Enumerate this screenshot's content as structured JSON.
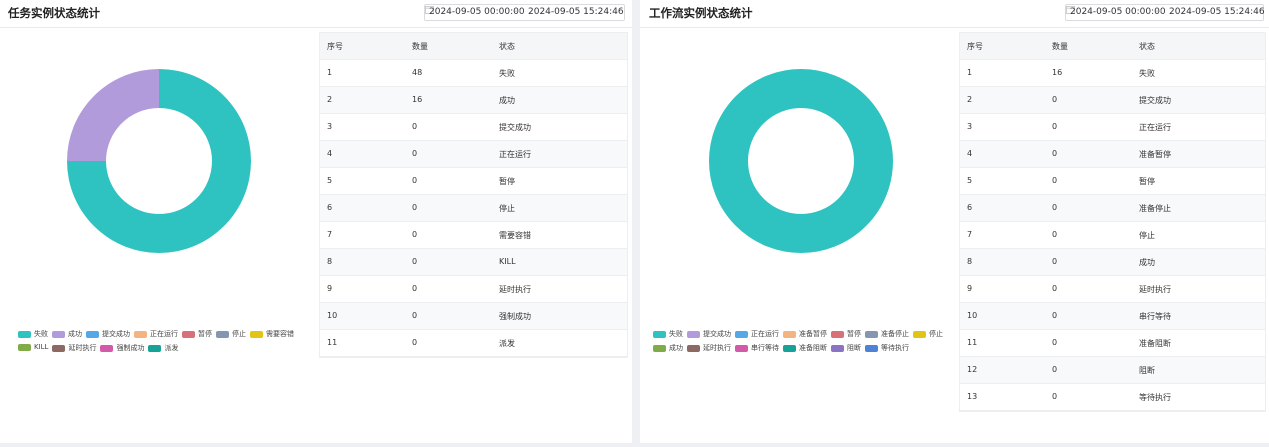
{
  "left": {
    "title": "任务实例状态统计",
    "date_start": "2024-09-05 00:00:00",
    "date_end": "2024-09-05 15:24:46",
    "date_arrow": "→",
    "columns": [
      "序号",
      "数量",
      "状态"
    ],
    "rows": [
      [
        "1",
        "48",
        "失败"
      ],
      [
        "2",
        "16",
        "成功"
      ],
      [
        "3",
        "0",
        "提交成功"
      ],
      [
        "4",
        "0",
        "正在运行"
      ],
      [
        "5",
        "0",
        "暂停"
      ],
      [
        "6",
        "0",
        "停止"
      ],
      [
        "7",
        "0",
        "需要容错"
      ],
      [
        "8",
        "0",
        "KILL"
      ],
      [
        "9",
        "0",
        "延时执行"
      ],
      [
        "10",
        "0",
        "强制成功"
      ],
      [
        "11",
        "0",
        "派发"
      ]
    ],
    "legend_rows": [
      [
        {
          "label": "失败",
          "color": "#2ec2c1"
        },
        {
          "label": "成功",
          "color": "#b19bdb"
        },
        {
          "label": "提交成功",
          "color": "#56a7e6"
        },
        {
          "label": "正在运行",
          "color": "#f3b482"
        },
        {
          "label": "暂停",
          "color": "#d8707a"
        },
        {
          "label": "停止",
          "color": "#8496b0"
        },
        {
          "label": "需要容错",
          "color": "#e2c415"
        }
      ],
      [
        {
          "label": "KILL",
          "color": "#80ab46"
        },
        {
          "label": "延时执行",
          "color": "#8c6a63"
        },
        {
          "label": "强制成功",
          "color": "#d35aa8"
        },
        {
          "label": "派发",
          "color": "#17a297"
        }
      ]
    ]
  },
  "right": {
    "title": "工作流实例状态统计",
    "date_start": "2024-09-05 00:00:00",
    "date_end": "2024-09-05 15:24:46",
    "date_arrow": "→",
    "columns": [
      "序号",
      "数量",
      "状态"
    ],
    "rows": [
      [
        "1",
        "16",
        "失败"
      ],
      [
        "2",
        "0",
        "提交成功"
      ],
      [
        "3",
        "0",
        "正在运行"
      ],
      [
        "4",
        "0",
        "准备暂停"
      ],
      [
        "5",
        "0",
        "暂停"
      ],
      [
        "6",
        "0",
        "准备停止"
      ],
      [
        "7",
        "0",
        "停止"
      ],
      [
        "8",
        "0",
        "成功"
      ],
      [
        "9",
        "0",
        "延时执行"
      ],
      [
        "10",
        "0",
        "串行等待"
      ],
      [
        "11",
        "0",
        "准备阻断"
      ],
      [
        "12",
        "0",
        "阻断"
      ],
      [
        "13",
        "0",
        "等待执行"
      ]
    ],
    "legend_rows": [
      [
        {
          "label": "失败",
          "color": "#2ec2c1"
        },
        {
          "label": "提交成功",
          "color": "#b19bdb"
        },
        {
          "label": "正在运行",
          "color": "#56a7e6"
        },
        {
          "label": "准备暂停",
          "color": "#f3b482"
        },
        {
          "label": "暂停",
          "color": "#d8707a"
        },
        {
          "label": "准备停止",
          "color": "#8496b0"
        },
        {
          "label": "停止",
          "color": "#e2c415"
        }
      ],
      [
        {
          "label": "成功",
          "color": "#80ab46"
        },
        {
          "label": "延时执行",
          "color": "#8c6a63"
        },
        {
          "label": "串行等待",
          "color": "#d35aa8"
        },
        {
          "label": "准备阻断",
          "color": "#17a297"
        },
        {
          "label": "阻断",
          "color": "#8d73c6"
        },
        {
          "label": "等待执行",
          "color": "#4d82d6"
        }
      ]
    ]
  },
  "chart_data": [
    {
      "type": "pie",
      "categories": [
        "失败",
        "成功",
        "提交成功",
        "正在运行",
        "暂停",
        "停止",
        "需要容错",
        "KILL",
        "延时执行",
        "强制成功",
        "派发"
      ],
      "values": [
        48,
        16,
        0,
        0,
        0,
        0,
        0,
        0,
        0,
        0,
        0
      ],
      "colors": [
        "#2ec2c1",
        "#b19bdb",
        "#56a7e6",
        "#f3b482",
        "#d8707a",
        "#8496b0",
        "#e2c415",
        "#80ab46",
        "#8c6a63",
        "#d35aa8",
        "#17a297"
      ],
      "legend_position": "bottom"
    },
    {
      "type": "pie",
      "categories": [
        "失败",
        "提交成功",
        "正在运行",
        "准备暂停",
        "暂停",
        "准备停止",
        "停止",
        "成功",
        "延时执行",
        "串行等待",
        "准备阻断",
        "阻断",
        "等待执行"
      ],
      "values": [
        16,
        0,
        0,
        0,
        0,
        0,
        0,
        0,
        0,
        0,
        0,
        0,
        0
      ],
      "colors": [
        "#2ec2c1",
        "#b19bdb",
        "#56a7e6",
        "#f3b482",
        "#d8707a",
        "#8496b0",
        "#e2c415",
        "#80ab46",
        "#8c6a63",
        "#d35aa8",
        "#17a297",
        "#8d73c6",
        "#4d82d6"
      ],
      "legend_position": "bottom"
    }
  ]
}
